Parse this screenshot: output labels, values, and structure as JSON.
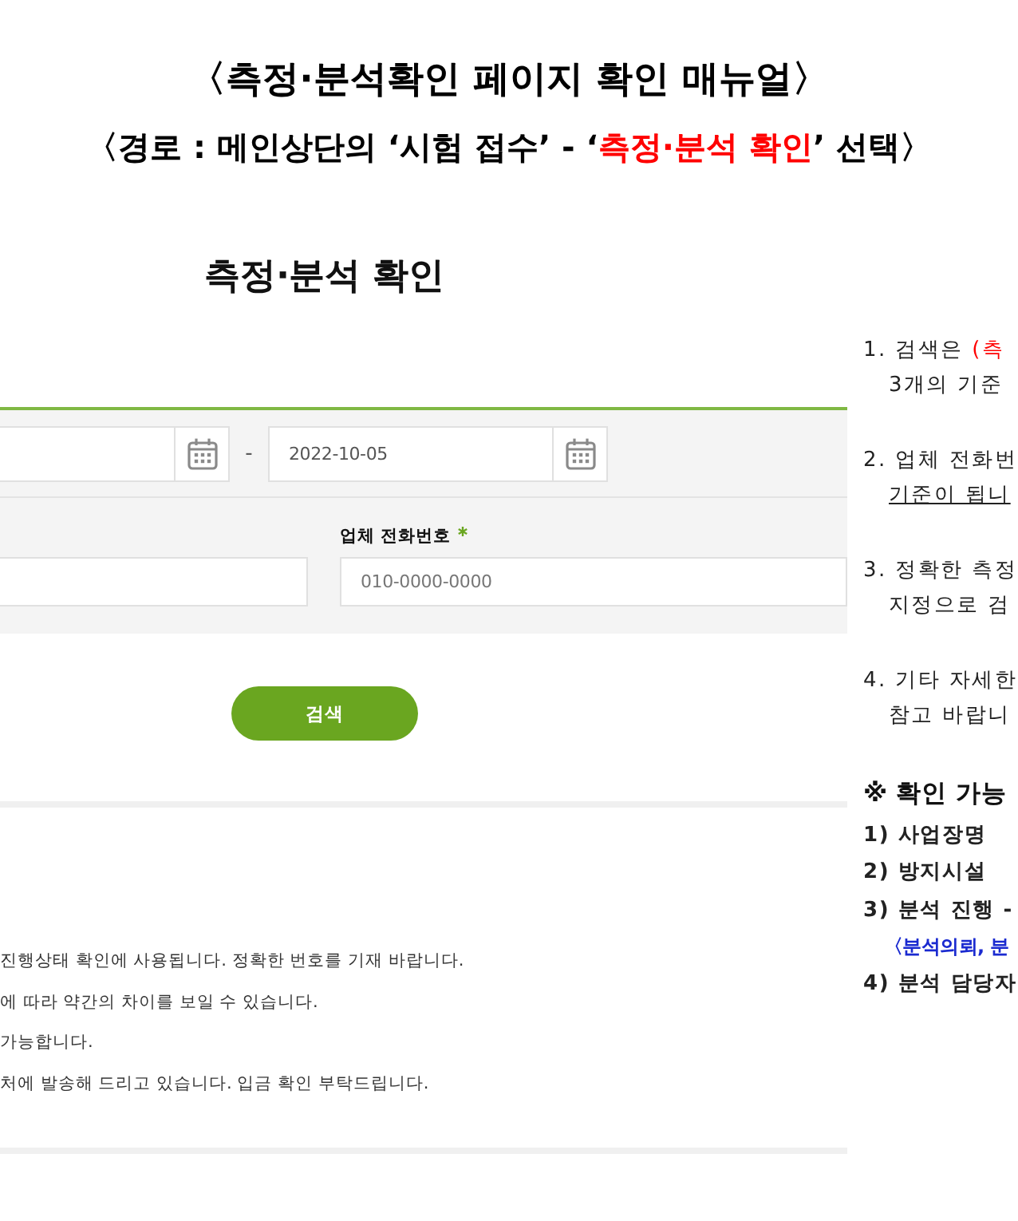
{
  "title": "〈측정·분석확인 페이지 확인 매뉴얼〉",
  "subtitle": [
    {
      "text": "〈경로 : 메인상단의 ‘시험 접수’ - ‘",
      "kind": "plain"
    },
    {
      "text": "측정·분석 확인",
      "kind": "red"
    },
    {
      "text": "’ 선택〉",
      "kind": "plain"
    }
  ],
  "screen": {
    "heading": "측정·분석 확인",
    "date_range": {
      "separator": "-",
      "to": "2022-10-05"
    },
    "fields": [
      {
        "kind": "unlabeled"
      },
      {
        "kind": "labeled",
        "label": "업체 전화번호",
        "required": true,
        "placeholder": "010-0000-0000"
      }
    ],
    "search_button": "검색",
    "notes": [
      "진행상태 확인에 사용됩니다. 정확한 번호를 기재 바랍니다.",
      "에 따라 약간의 차이를 보일 수 있습니다.",
      "가능합니다.",
      "처에 발송해 드리고 있습니다. 입금 확인 부탁드립니다."
    ]
  },
  "guide": {
    "steps": [
      {
        "lines": [
          [
            {
              "text": "1. 검색은 ",
              "kind": "plain"
            },
            {
              "text": "(측",
              "kind": "red"
            }
          ],
          [
            {
              "text": "3개의 기준",
              "kind": "plain"
            }
          ]
        ]
      },
      {
        "lines": [
          [
            {
              "text": "2. 업체 전화번",
              "kind": "plain"
            }
          ],
          [
            {
              "text": "기준이 됩니",
              "kind": "underline"
            }
          ]
        ]
      },
      {
        "lines": [
          [
            {
              "text": "3. 정확한 측정",
              "kind": "plain"
            }
          ],
          [
            {
              "text": "지정으로 검",
              "kind": "plain"
            }
          ]
        ]
      },
      {
        "lines": [
          [
            {
              "text": "4. 기타 자세한",
              "kind": "plain"
            }
          ],
          [
            {
              "text": "참고 바랍니",
              "kind": "plain"
            }
          ]
        ]
      }
    ],
    "heading": "※ 확인 가능",
    "items": [
      {
        "text": "1) 사업장명",
        "kind": "item"
      },
      {
        "text": "2) 방지시설",
        "kind": "item"
      },
      {
        "text": "3) 분석 진행 -",
        "kind": "item"
      },
      {
        "text": "〈분석의뢰, 분",
        "kind": "note"
      },
      {
        "text": "4) 분석 담당자",
        "kind": "item"
      }
    ]
  }
}
